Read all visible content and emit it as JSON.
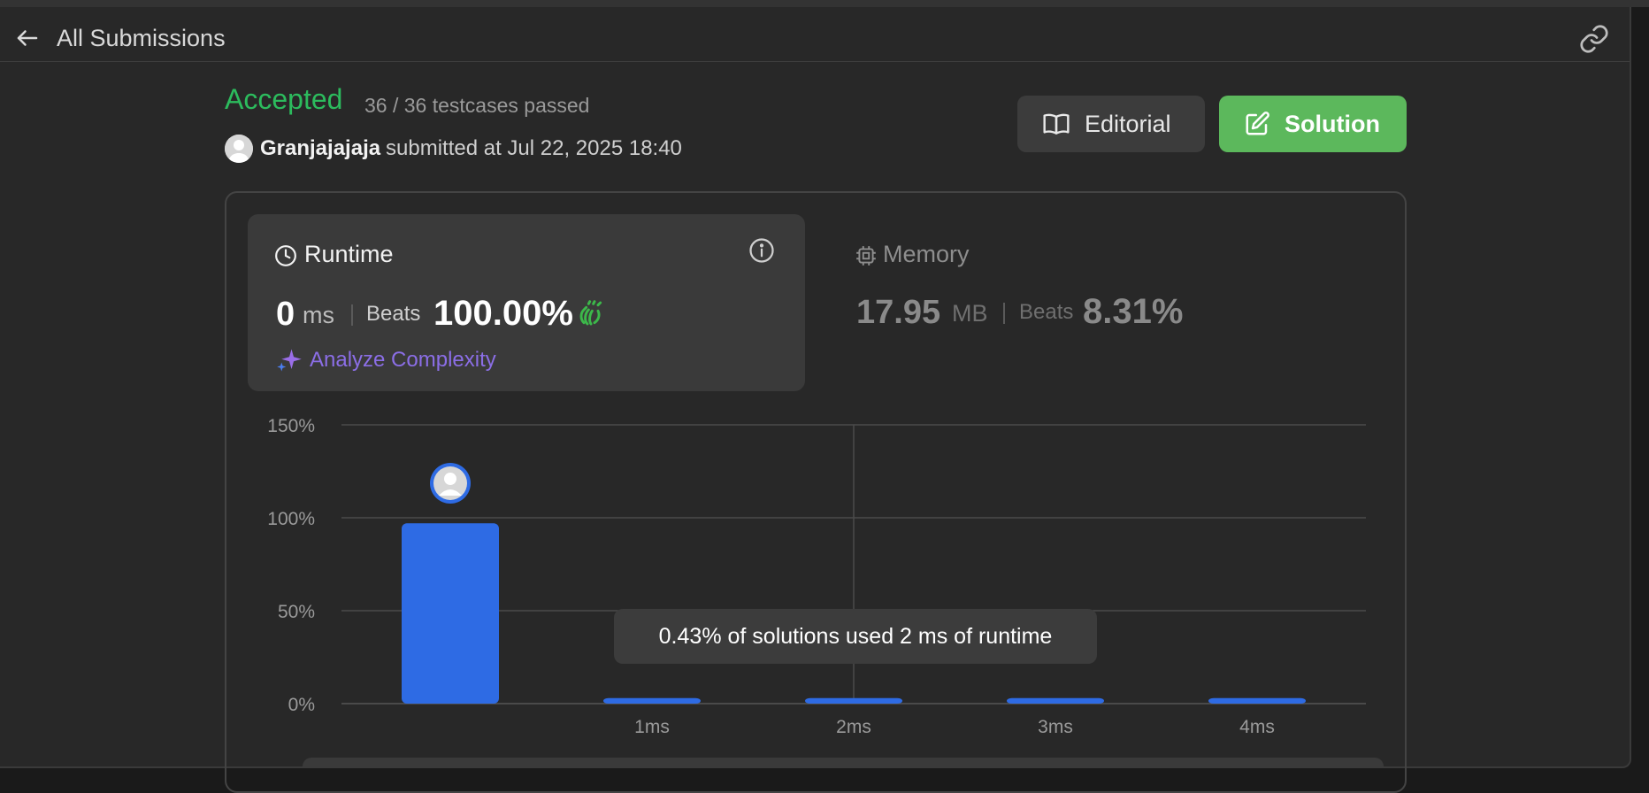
{
  "header": {
    "title": "All Submissions",
    "back_icon": "arrow-left-icon",
    "link_icon": "link-icon"
  },
  "submission": {
    "status": "Accepted",
    "status_color": "#2cbb5d",
    "testcases": "36 / 36 testcases passed",
    "username": "Granjajajaja",
    "submitted_text": "submitted at Jul 22, 2025 18:40"
  },
  "buttons": {
    "editorial_label": "Editorial",
    "solution_label": "Solution",
    "solution_color": "#5cb85c"
  },
  "runtime": {
    "title": "Runtime",
    "value": "0",
    "unit": "ms",
    "beats_label": "Beats",
    "beats_value": "100.00%",
    "analyze_label": "Analyze Complexity"
  },
  "memory": {
    "title": "Memory",
    "value": "17.95",
    "unit": "MB",
    "beats_label": "Beats",
    "beats_value": "8.31%"
  },
  "tooltip": {
    "text": "0.43% of solutions used 2 ms of runtime"
  },
  "chart_data": {
    "type": "bar",
    "categories": [
      "0ms",
      "1ms",
      "2ms",
      "3ms",
      "4ms"
    ],
    "tick_labels": [
      "",
      "1ms",
      "2ms",
      "3ms",
      "4ms"
    ],
    "values": [
      97,
      3,
      3,
      3,
      3
    ],
    "ylim": [
      0,
      150
    ],
    "yticks": [
      "0%",
      "50%",
      "100%",
      "150%"
    ],
    "ytick_values": [
      0,
      50,
      100,
      150
    ],
    "bar_color": "#2e6be4",
    "grid": true,
    "highlight_category": "0ms",
    "hover_category": "2ms"
  }
}
